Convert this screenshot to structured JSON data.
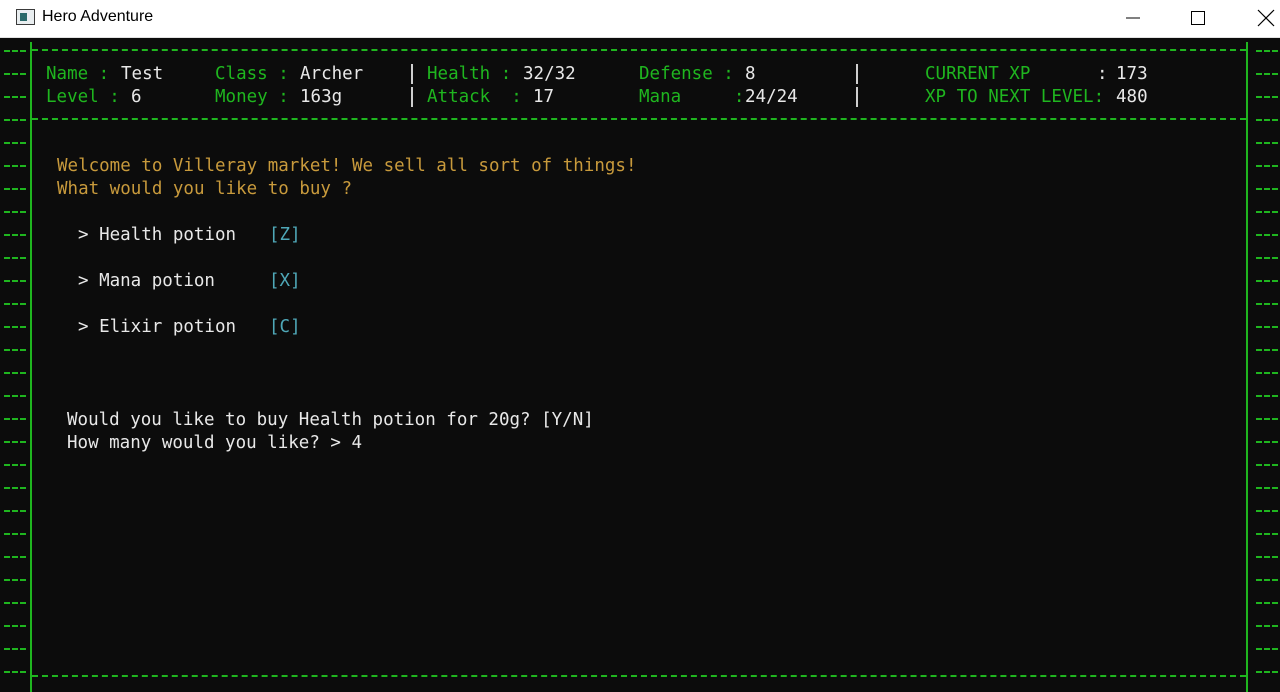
{
  "window": {
    "title": "Hero Adventure"
  },
  "stats": {
    "name_label": "Name :",
    "name_value": "Test",
    "level_label": "Level :",
    "level_value": "6",
    "class_label": "Class :",
    "class_value": "Archer",
    "money_label": "Money :",
    "money_value": "163g",
    "health_label": "Health :",
    "health_value": "32/32",
    "attack_label": "Attack  :",
    "attack_value": "17",
    "defense_label": "Defense :",
    "defense_value": "8",
    "mana_label": "Mana     :",
    "mana_value": "24/24",
    "current_xp_label": "CURRENT XP",
    "current_xp_colon": ":",
    "current_xp_value": "173",
    "next_level_label": "XP TO NEXT LEVEL:",
    "next_level_value": "480"
  },
  "shop": {
    "welcome": "Welcome to Villeray market! We sell all sort of things!",
    "question": "What would you like to buy ?",
    "items": [
      {
        "label": "> Health potion",
        "key": "[Z]"
      },
      {
        "label": "> Mana potion",
        "key": "[X]"
      },
      {
        "label": "> Elixir potion",
        "key": "[C]"
      }
    ],
    "confirm_prompt": "Would you like to buy Health potion for 20g? [Y/N]",
    "quantity_prompt": "How many would you like? > 4"
  },
  "colors": {
    "border": "#1fb61f",
    "label": "#1fb61f",
    "value": "#e8e8e8",
    "shop_text": "#c89a3c",
    "key_hint": "#4fa8b8",
    "background": "#0c0c0c"
  }
}
